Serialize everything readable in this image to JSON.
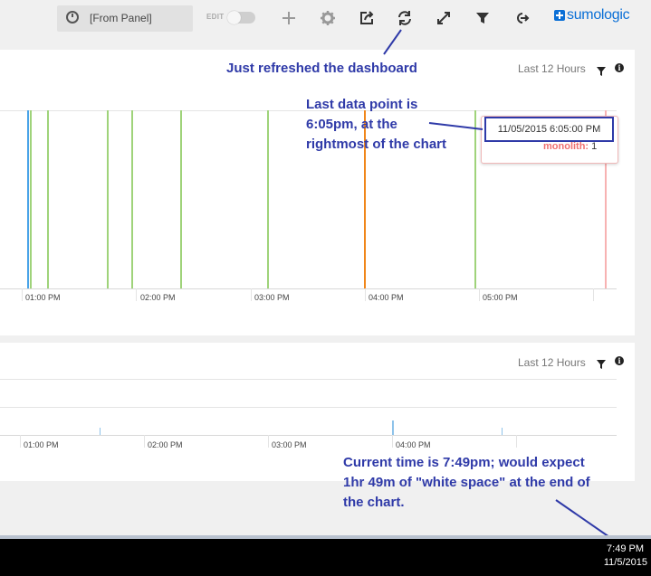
{
  "toolbar": {
    "time_range": "[From Panel]",
    "edit_label": "EDIT",
    "icons": [
      "plus-icon",
      "gear-icon",
      "share-icon",
      "refresh-icon",
      "expand-icon",
      "filter-icon",
      "exit-icon"
    ],
    "logo": "sumologic",
    "accent": "#0a6fd6"
  },
  "panel1": {
    "range": "Last 12 Hours",
    "ticks": [
      "01:00 PM",
      "02:00 PM",
      "03:00 PM",
      "04:00 PM",
      "05:00 PM"
    ],
    "tooltip": {
      "date": "11/05/2015 6:05:00 PM",
      "series": "monolith:",
      "value": "1"
    },
    "series_colors": {
      "monolith": "#f07070",
      "green": "#9fd37a",
      "orange": "#f0861a",
      "blue": "#4aa3e8"
    }
  },
  "panel2": {
    "range": "Last 12 Hours",
    "ticks": [
      "01:00 PM",
      "02:00 PM",
      "03:00 PM",
      "04:00 PM"
    ]
  },
  "annotations": {
    "refresh": "Just refreshed the dashboard",
    "last_point": [
      "Last data point is",
      "6:05pm, at the",
      "rightmost of the chart"
    ],
    "current_time": [
      "Current time is 7:49pm; would expect",
      "1hr 49m of \"white space\" at the end of",
      "the chart."
    ]
  },
  "taskbar": {
    "time": "7:49 PM",
    "date": "11/5/2015"
  }
}
